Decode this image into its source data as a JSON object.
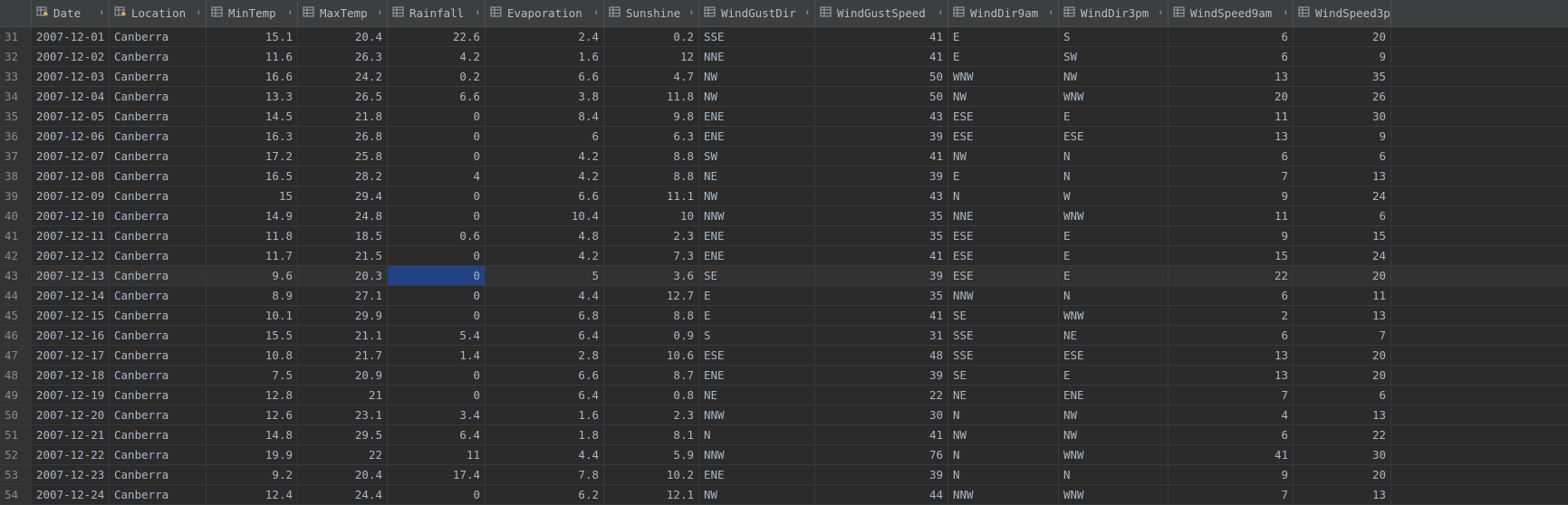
{
  "columns": [
    {
      "label": "Date",
      "icon": "key-table-column-icon"
    },
    {
      "label": "Location",
      "icon": "key-table-column-icon"
    },
    {
      "label": "MinTemp",
      "icon": "table-column-icon"
    },
    {
      "label": "MaxTemp",
      "icon": "table-column-icon"
    },
    {
      "label": "Rainfall",
      "icon": "table-column-icon"
    },
    {
      "label": "Evaporation",
      "icon": "table-column-icon"
    },
    {
      "label": "Sunshine",
      "icon": "table-column-icon"
    },
    {
      "label": "WindGustDir",
      "icon": "table-column-icon"
    },
    {
      "label": "WindGustSpeed",
      "icon": "table-column-icon"
    },
    {
      "label": "WindDir9am",
      "icon": "table-column-icon"
    },
    {
      "label": "WindDir3pm",
      "icon": "table-column-icon"
    },
    {
      "label": "WindSpeed9am",
      "icon": "table-column-icon"
    },
    {
      "label": "WindSpeed3pm",
      "icon": "table-column-icon"
    }
  ],
  "sort_glyph": "⬍",
  "selected_row_index": 12,
  "selected_col_index": 4,
  "rows": [
    {
      "n": "31",
      "c": [
        "2007-12-01",
        "Canberra",
        "15.1",
        "20.4",
        "22.6",
        "2.4",
        "0.2",
        "SSE",
        "41",
        "E",
        "S",
        "6",
        "20"
      ]
    },
    {
      "n": "32",
      "c": [
        "2007-12-02",
        "Canberra",
        "11.6",
        "26.3",
        "4.2",
        "1.6",
        "12",
        "NNE",
        "41",
        "E",
        "SW",
        "6",
        "9"
      ]
    },
    {
      "n": "33",
      "c": [
        "2007-12-03",
        "Canberra",
        "16.6",
        "24.2",
        "0.2",
        "6.6",
        "4.7",
        "NW",
        "50",
        "WNW",
        "NW",
        "13",
        "35"
      ]
    },
    {
      "n": "34",
      "c": [
        "2007-12-04",
        "Canberra",
        "13.3",
        "26.5",
        "6.6",
        "3.8",
        "11.8",
        "NW",
        "50",
        "NW",
        "WNW",
        "20",
        "26"
      ]
    },
    {
      "n": "35",
      "c": [
        "2007-12-05",
        "Canberra",
        "14.5",
        "21.8",
        "0",
        "8.4",
        "9.8",
        "ENE",
        "43",
        "ESE",
        "E",
        "11",
        "30"
      ]
    },
    {
      "n": "36",
      "c": [
        "2007-12-06",
        "Canberra",
        "16.3",
        "26.8",
        "0",
        "6",
        "6.3",
        "ENE",
        "39",
        "ESE",
        "ESE",
        "13",
        "9"
      ]
    },
    {
      "n": "37",
      "c": [
        "2007-12-07",
        "Canberra",
        "17.2",
        "25.8",
        "0",
        "4.2",
        "8.8",
        "SW",
        "41",
        "NW",
        "N",
        "6",
        "6"
      ]
    },
    {
      "n": "38",
      "c": [
        "2007-12-08",
        "Canberra",
        "16.5",
        "28.2",
        "4",
        "4.2",
        "8.8",
        "NE",
        "39",
        "E",
        "N",
        "7",
        "13"
      ]
    },
    {
      "n": "39",
      "c": [
        "2007-12-09",
        "Canberra",
        "15",
        "29.4",
        "0",
        "6.6",
        "11.1",
        "NW",
        "43",
        "N",
        "W",
        "9",
        "24"
      ]
    },
    {
      "n": "40",
      "c": [
        "2007-12-10",
        "Canberra",
        "14.9",
        "24.8",
        "0",
        "10.4",
        "10",
        "NNW",
        "35",
        "NNE",
        "WNW",
        "11",
        "6"
      ]
    },
    {
      "n": "41",
      "c": [
        "2007-12-11",
        "Canberra",
        "11.8",
        "18.5",
        "0.6",
        "4.8",
        "2.3",
        "ENE",
        "35",
        "ESE",
        "E",
        "9",
        "15"
      ]
    },
    {
      "n": "42",
      "c": [
        "2007-12-12",
        "Canberra",
        "11.7",
        "21.5",
        "0",
        "4.2",
        "7.3",
        "ENE",
        "41",
        "ESE",
        "E",
        "15",
        "24"
      ]
    },
    {
      "n": "43",
      "c": [
        "2007-12-13",
        "Canberra",
        "9.6",
        "20.3",
        "0",
        "5",
        "3.6",
        "SE",
        "39",
        "ESE",
        "E",
        "22",
        "20"
      ]
    },
    {
      "n": "44",
      "c": [
        "2007-12-14",
        "Canberra",
        "8.9",
        "27.1",
        "0",
        "4.4",
        "12.7",
        "E",
        "35",
        "NNW",
        "N",
        "6",
        "11"
      ]
    },
    {
      "n": "45",
      "c": [
        "2007-12-15",
        "Canberra",
        "10.1",
        "29.9",
        "0",
        "6.8",
        "8.8",
        "E",
        "41",
        "SE",
        "WNW",
        "2",
        "13"
      ]
    },
    {
      "n": "46",
      "c": [
        "2007-12-16",
        "Canberra",
        "15.5",
        "21.1",
        "5.4",
        "6.4",
        "0.9",
        "S",
        "31",
        "SSE",
        "NE",
        "6",
        "7"
      ]
    },
    {
      "n": "47",
      "c": [
        "2007-12-17",
        "Canberra",
        "10.8",
        "21.7",
        "1.4",
        "2.8",
        "10.6",
        "ESE",
        "48",
        "SSE",
        "ESE",
        "13",
        "20"
      ]
    },
    {
      "n": "48",
      "c": [
        "2007-12-18",
        "Canberra",
        "7.5",
        "20.9",
        "0",
        "6.6",
        "8.7",
        "ENE",
        "39",
        "SE",
        "E",
        "13",
        "20"
      ]
    },
    {
      "n": "49",
      "c": [
        "2007-12-19",
        "Canberra",
        "12.8",
        "21",
        "0",
        "6.4",
        "0.8",
        "NE",
        "22",
        "NE",
        "ENE",
        "7",
        "6"
      ]
    },
    {
      "n": "50",
      "c": [
        "2007-12-20",
        "Canberra",
        "12.6",
        "23.1",
        "3.4",
        "1.6",
        "2.3",
        "NNW",
        "30",
        "N",
        "NW",
        "4",
        "13"
      ]
    },
    {
      "n": "51",
      "c": [
        "2007-12-21",
        "Canberra",
        "14.8",
        "29.5",
        "6.4",
        "1.8",
        "8.1",
        "N",
        "41",
        "NW",
        "NW",
        "6",
        "22"
      ]
    },
    {
      "n": "52",
      "c": [
        "2007-12-22",
        "Canberra",
        "19.9",
        "22",
        "11",
        "4.4",
        "5.9",
        "NNW",
        "76",
        "N",
        "WNW",
        "41",
        "30"
      ]
    },
    {
      "n": "53",
      "c": [
        "2007-12-23",
        "Canberra",
        "9.2",
        "20.4",
        "17.4",
        "7.8",
        "10.2",
        "ENE",
        "39",
        "N",
        "N",
        "9",
        "20"
      ]
    },
    {
      "n": "54",
      "c": [
        "2007-12-24",
        "Canberra",
        "12.4",
        "24.4",
        "0",
        "6.2",
        "12.1",
        "NW",
        "44",
        "NNW",
        "WNW",
        "7",
        "13"
      ]
    }
  ]
}
